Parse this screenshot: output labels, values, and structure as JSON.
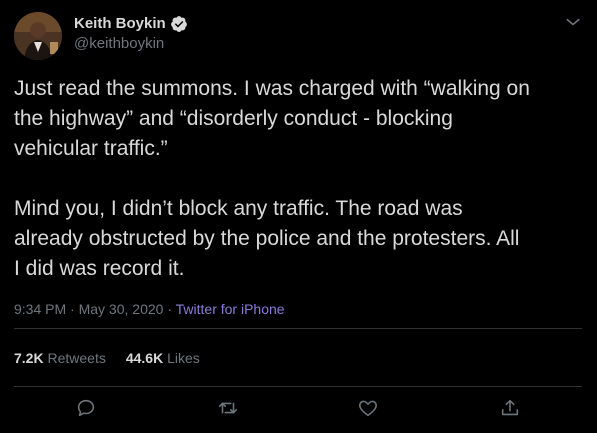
{
  "author": {
    "display_name": "Keith Boykin",
    "handle": "@keithboykin",
    "verified": true
  },
  "tweet": {
    "text": "Just read the summons. I was charged with “walking on\nthe highway” and “disorderly conduct - blocking\nvehicular traffic.”\n\nMind you, I didn’t block any traffic. The road was\nalready obstructed by the police and the protesters. All\nI did was record it.",
    "time": "9:34 PM",
    "separator": " · ",
    "date": "May 30, 2020",
    "source": "Twitter for iPhone"
  },
  "stats": {
    "retweets_count": "7.2K",
    "retweets_label": "Retweets",
    "likes_count": "44.6K",
    "likes_label": "Likes"
  },
  "icons": {
    "more": "chevron-down-icon",
    "verified": "verified-badge-icon",
    "reply": "reply-icon",
    "retweet": "retweet-icon",
    "like": "heart-icon",
    "share": "share-icon"
  },
  "colors": {
    "background": "#000000",
    "text": "#d9d9d9",
    "muted": "#6e767d",
    "link": "#8b7bd8",
    "divider": "#2f3336"
  }
}
